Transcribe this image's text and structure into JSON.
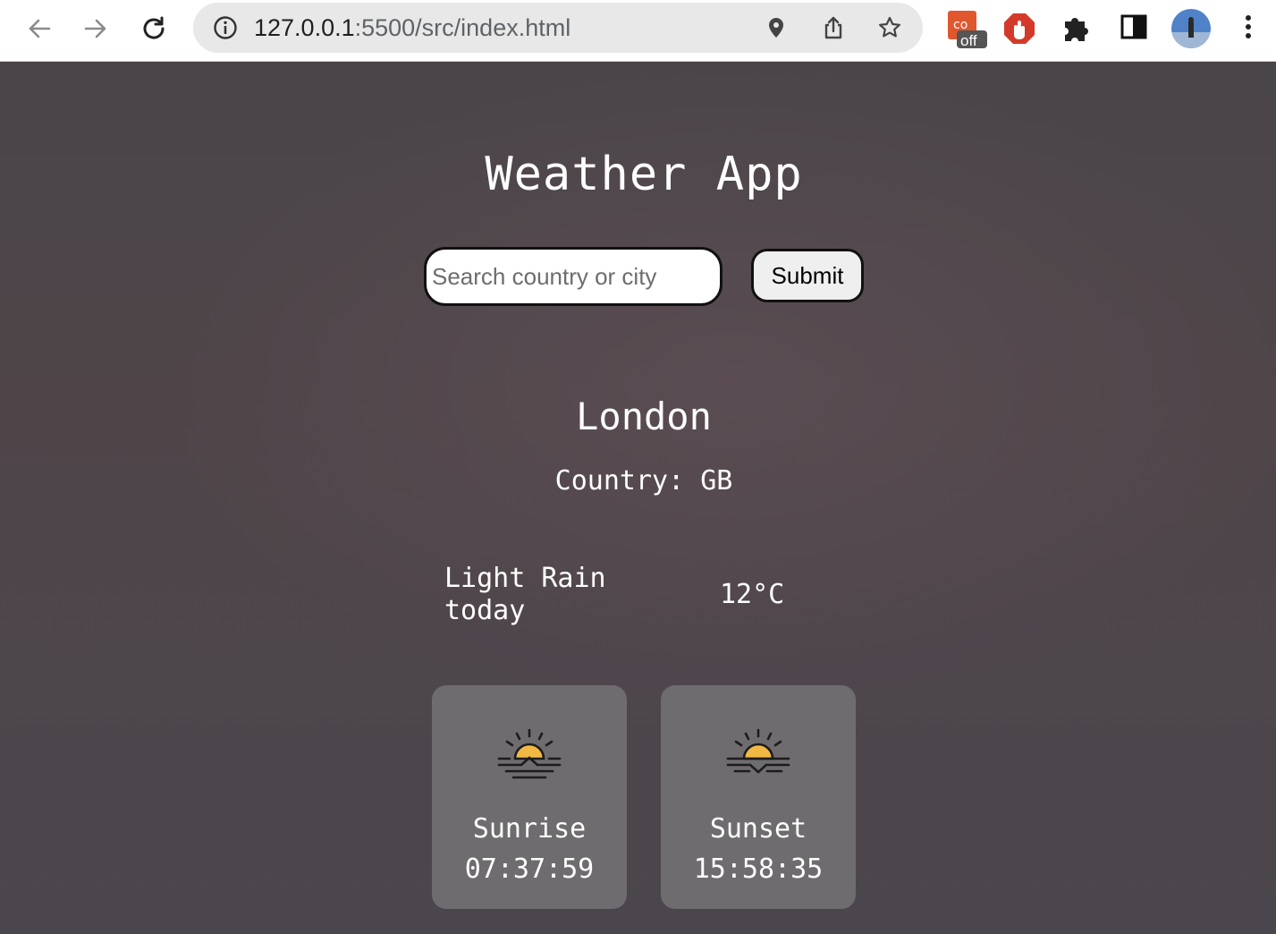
{
  "browser": {
    "url_host": "127.0.0.1",
    "url_rest": ":5500/src/index.html",
    "extension_badge": "off"
  },
  "app": {
    "title": "Weather App",
    "search": {
      "placeholder": "Search country or city",
      "value": ""
    },
    "submit_label": "Submit"
  },
  "weather": {
    "city": "London",
    "country_label": "Country:",
    "country_code": "GB",
    "description": "Light Rain today",
    "temperature": "12°C"
  },
  "sun": {
    "sunrise_label": "Sunrise",
    "sunrise_time": "07:37:59",
    "sunset_label": "Sunset",
    "sunset_time": "15:58:35"
  },
  "colors": {
    "page_background": "#4b464b",
    "card_background": "#6f6c6f",
    "sun_yellow": "#f2b844"
  },
  "icons": [
    "back-arrow-icon",
    "forward-arrow-icon",
    "reload-icon",
    "info-icon",
    "location-pin-icon",
    "share-icon",
    "star-icon",
    "extension-icon",
    "adblock-icon",
    "puzzle-icon",
    "sidepanel-icon",
    "profile-avatar",
    "kebab-menu-icon",
    "sunrise-icon",
    "sunset-icon"
  ]
}
